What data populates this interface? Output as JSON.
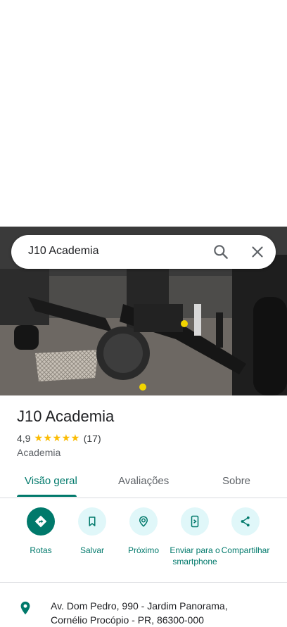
{
  "search": {
    "query": "J10 Academia"
  },
  "place": {
    "name": "J10 Academia",
    "rating": "4,9",
    "stars": "★★★★★",
    "reviews_count": "(17)",
    "category": "Academia"
  },
  "tabs": [
    {
      "label": "Visão geral",
      "active": true
    },
    {
      "label": "Avaliações",
      "active": false
    },
    {
      "label": "Sobre",
      "active": false
    }
  ],
  "actions": [
    {
      "label": "Rotas",
      "icon": "directions-icon"
    },
    {
      "label": "Salvar",
      "icon": "bookmark-icon"
    },
    {
      "label": "Próximo",
      "icon": "nearby-icon"
    },
    {
      "label": "Enviar para o smartphone",
      "icon": "send-to-phone-icon"
    },
    {
      "label": "Compartilhar",
      "icon": "share-icon"
    }
  ],
  "address": {
    "line1": "Av. Dom Pedro, 990 - Jardim Panorama,",
    "line2": "Cornélio Procópio - PR, 86300-000"
  },
  "colors": {
    "accent": "#00796b",
    "action_bg": "#e0f7f9",
    "star": "#fbbc04"
  }
}
